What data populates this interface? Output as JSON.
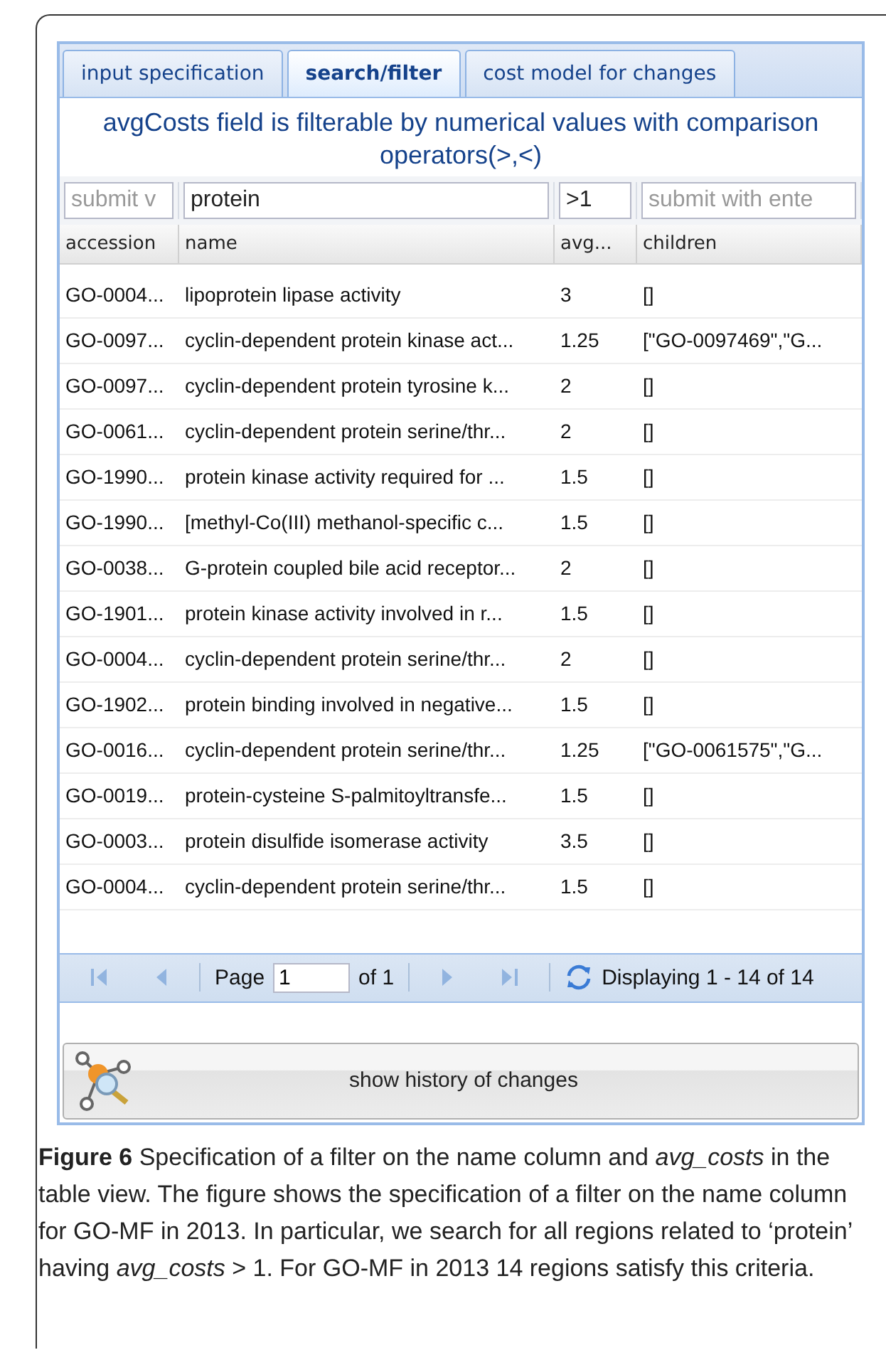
{
  "tabs": [
    {
      "label": "input specification",
      "selected": false
    },
    {
      "label": "search/filter",
      "selected": true
    },
    {
      "label": "cost model for changes",
      "selected": false
    }
  ],
  "hint": "avgCosts field is filterable by numerical values with comparison operators(>,<)",
  "filters": [
    {
      "placeholder": "submit v"
    },
    {
      "value": "protein"
    },
    {
      "value": ">1"
    },
    {
      "placeholder": "submit with ente"
    }
  ],
  "table": {
    "columns": [
      "accession",
      "name",
      "avg...",
      "children"
    ],
    "rows": [
      [
        "GO-0004...",
        "lipoprotein lipase activity",
        "3",
        "[]"
      ],
      [
        "GO-0097...",
        "cyclin-dependent protein kinase act...",
        "1.25",
        "[\"GO-0097469\",\"G..."
      ],
      [
        "GO-0097...",
        "cyclin-dependent protein tyrosine k...",
        "2",
        "[]"
      ],
      [
        "GO-0061...",
        "cyclin-dependent protein serine/thr...",
        "2",
        "[]"
      ],
      [
        "GO-1990...",
        "protein kinase activity required for ...",
        "1.5",
        "[]"
      ],
      [
        "GO-1990...",
        "[methyl-Co(III) methanol-specific c...",
        "1.5",
        "[]"
      ],
      [
        "GO-0038...",
        "G-protein coupled bile acid receptor...",
        "2",
        "[]"
      ],
      [
        "GO-1901...",
        "protein kinase activity involved in r...",
        "1.5",
        "[]"
      ],
      [
        "GO-0004...",
        "cyclin-dependent protein serine/thr...",
        "2",
        "[]"
      ],
      [
        "GO-1902...",
        "protein binding involved in negative...",
        "1.5",
        "[]"
      ],
      [
        "GO-0016...",
        "cyclin-dependent protein serine/thr...",
        "1.25",
        "[\"GO-0061575\",\"G..."
      ],
      [
        "GO-0019...",
        "protein-cysteine S-palmitoyltransfe...",
        "1.5",
        "[]"
      ],
      [
        "GO-0003...",
        "protein disulfide isomerase activity",
        "3.5",
        "[]"
      ],
      [
        "GO-0004...",
        "cyclin-dependent protein serine/thr...",
        "1.5",
        "[]"
      ]
    ]
  },
  "pager": {
    "nav": [
      {
        "kind": "first",
        "disabled": true
      },
      {
        "kind": "prev",
        "disabled": true
      },
      {
        "kind": "next",
        "disabled": true
      },
      {
        "kind": "last",
        "disabled": true
      }
    ],
    "page_label": "Page",
    "page_value": "1",
    "of_label": "of 1",
    "display": "Displaying 1 - 14 of 14"
  },
  "history_button": "show history of changes",
  "caption": "**Figure 6**  Specification of a filter on the name column and *avg_costs* in the table view. The figure shows the specification of a filter on the name column for GO-MF in 2013. In particular, we search for all regions related to ‘protein’ having *avg_costs* > 1. For GO-MF in 2013 14 regions satisfy this criteria."
}
